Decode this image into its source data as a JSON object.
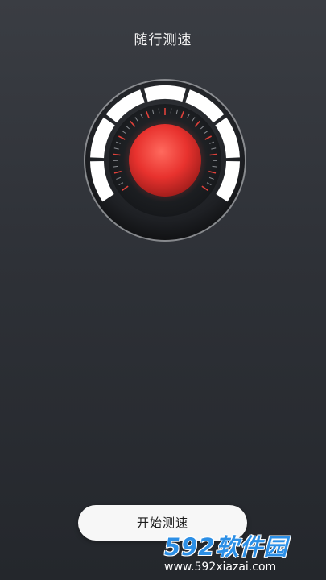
{
  "header": {
    "title": "随行测速"
  },
  "gauge": {
    "center_color": "#e8322e",
    "tick_accent_color": "#e0413a",
    "segment_color": "#ffffff"
  },
  "actions": {
    "start_label": "开始测速"
  },
  "watermark": {
    "brand": "592软件园",
    "url": "www.592xiazai.com",
    "color": "#2c8fe6"
  }
}
